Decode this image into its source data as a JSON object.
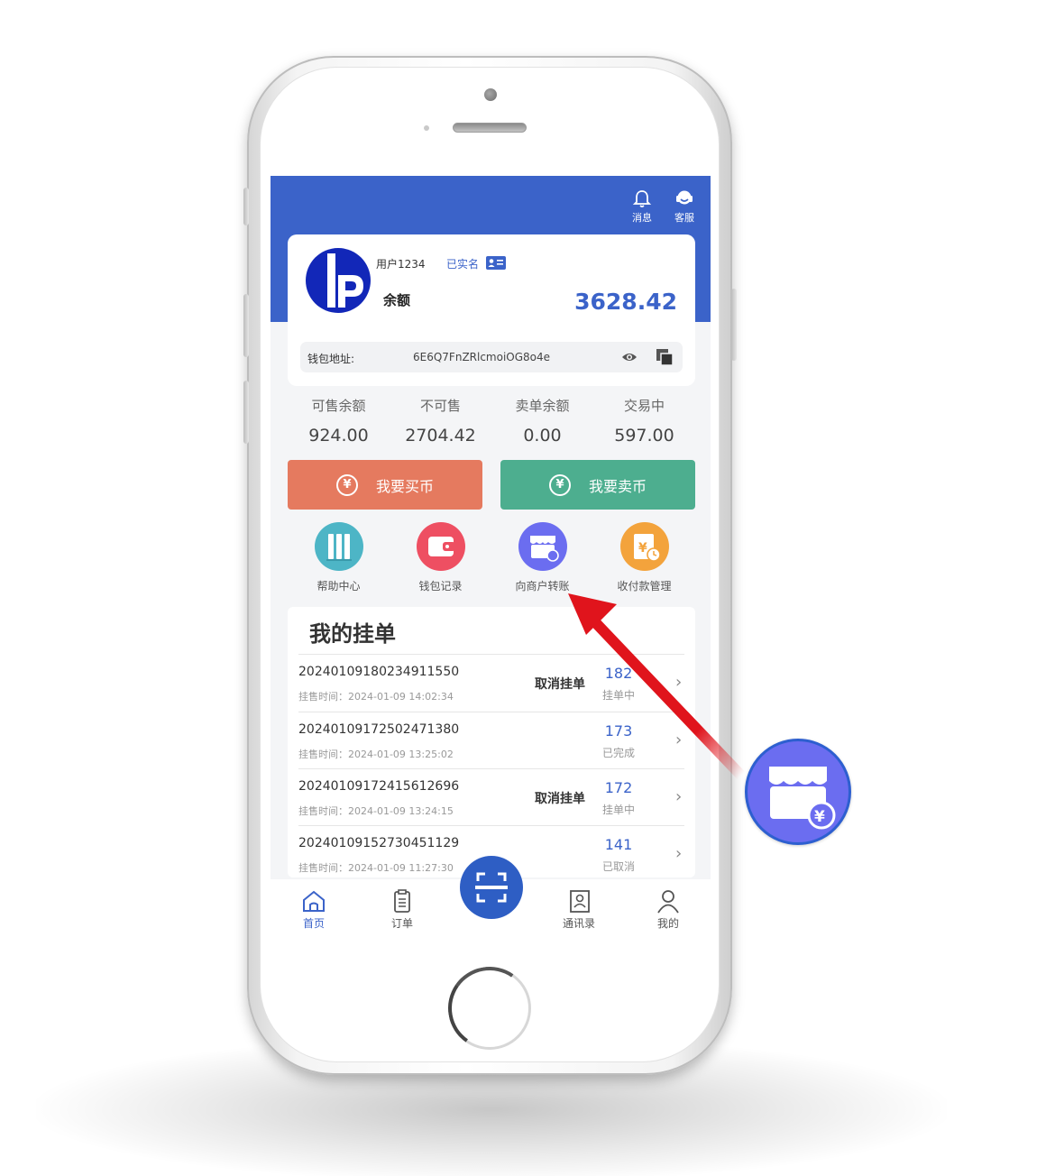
{
  "header": {
    "messages_label": "消息",
    "service_label": "客服"
  },
  "account": {
    "username": "用户1234",
    "verified_label": "已实名",
    "balance_label": "余额",
    "balance_value": "3628.42",
    "wallet_label": "钱包地址:",
    "wallet_address": "6E6Q7FnZRlcmoiOG8o4e"
  },
  "stats": [
    {
      "label": "可售余额",
      "value": "924.00"
    },
    {
      "label": "不可售",
      "value": "2704.42"
    },
    {
      "label": "卖单余额",
      "value": "0.00"
    },
    {
      "label": "交易中",
      "value": "597.00"
    }
  ],
  "actions": {
    "buy_label": "我要买币",
    "sell_label": "我要卖币",
    "buy_color": "#e57a5f",
    "sell_color": "#4dae8f"
  },
  "quick_links": [
    {
      "label": "帮助中心",
      "icon": "books-icon",
      "color": "#4db5c6"
    },
    {
      "label": "钱包记录",
      "icon": "wallet-icon",
      "color": "#ee4f62"
    },
    {
      "label": "向商户转账",
      "icon": "store-transfer-icon",
      "color": "#6b6df0"
    },
    {
      "label": "收付款管理",
      "icon": "payment-manage-icon",
      "color": "#f3a33c"
    }
  ],
  "orders": {
    "title": "我的挂单",
    "items": [
      {
        "id": "20240109180234911550",
        "time": "挂售时间：2024-01-09 14:02:34",
        "cancel": "取消挂单",
        "num": "182",
        "status": "挂单中"
      },
      {
        "id": "20240109172502471380",
        "time": "挂售时间：2024-01-09 13:25:02",
        "cancel": "",
        "num": "173",
        "status": "已完成"
      },
      {
        "id": "20240109172415612696",
        "time": "挂售时间：2024-01-09 13:24:15",
        "cancel": "取消挂单",
        "num": "172",
        "status": "挂单中"
      },
      {
        "id": "20240109152730451129",
        "time": "挂售时间：2024-01-09 11:27:30",
        "cancel": "",
        "num": "141",
        "status": "已取消"
      }
    ]
  },
  "nav": {
    "home": "首页",
    "orders": "订单",
    "contacts": "通讯录",
    "mine": "我的"
  },
  "colors": {
    "brand": "#3b63c9",
    "annotation_arrow": "#e0141c"
  }
}
